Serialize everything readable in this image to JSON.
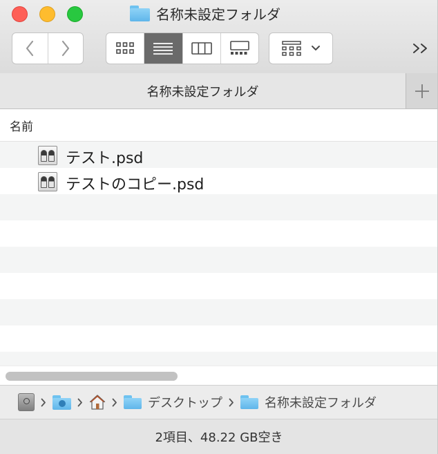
{
  "window": {
    "title": "名称未設定フォルダ"
  },
  "toolbar": {
    "nav_back": "back",
    "nav_forward": "forward",
    "views": [
      "icon-view",
      "list-view",
      "column-view",
      "gallery-view"
    ],
    "selected_view": "list-view",
    "arrange_control": "group-arrange",
    "overflow_glyph": ">>"
  },
  "tabs": {
    "active_label": "名称未設定フォルダ",
    "add_glyph": "+"
  },
  "list": {
    "column_name": "名前",
    "files": [
      {
        "name": "テスト.psd",
        "icon": "psd-file-icon"
      },
      {
        "name": "テストのコピー.psd",
        "icon": "psd-file-icon"
      }
    ]
  },
  "pathbar": {
    "items": [
      {
        "label": "",
        "icon": "hard-drive-icon"
      },
      {
        "label": "",
        "icon": "user-folder-icon"
      },
      {
        "label": "",
        "icon": "home-icon"
      },
      {
        "label": "デスクトップ",
        "icon": "folder-icon"
      },
      {
        "label": "名称未設定フォルダ",
        "icon": "folder-icon"
      }
    ]
  },
  "status": {
    "text": "2項目、48.22 GB空き"
  },
  "colors": {
    "folder_blue": "#5fb6ea",
    "close": "#fe5f57",
    "minimize": "#febc2e",
    "zoom": "#28c840",
    "selected_segment": "#6a6a6a"
  }
}
